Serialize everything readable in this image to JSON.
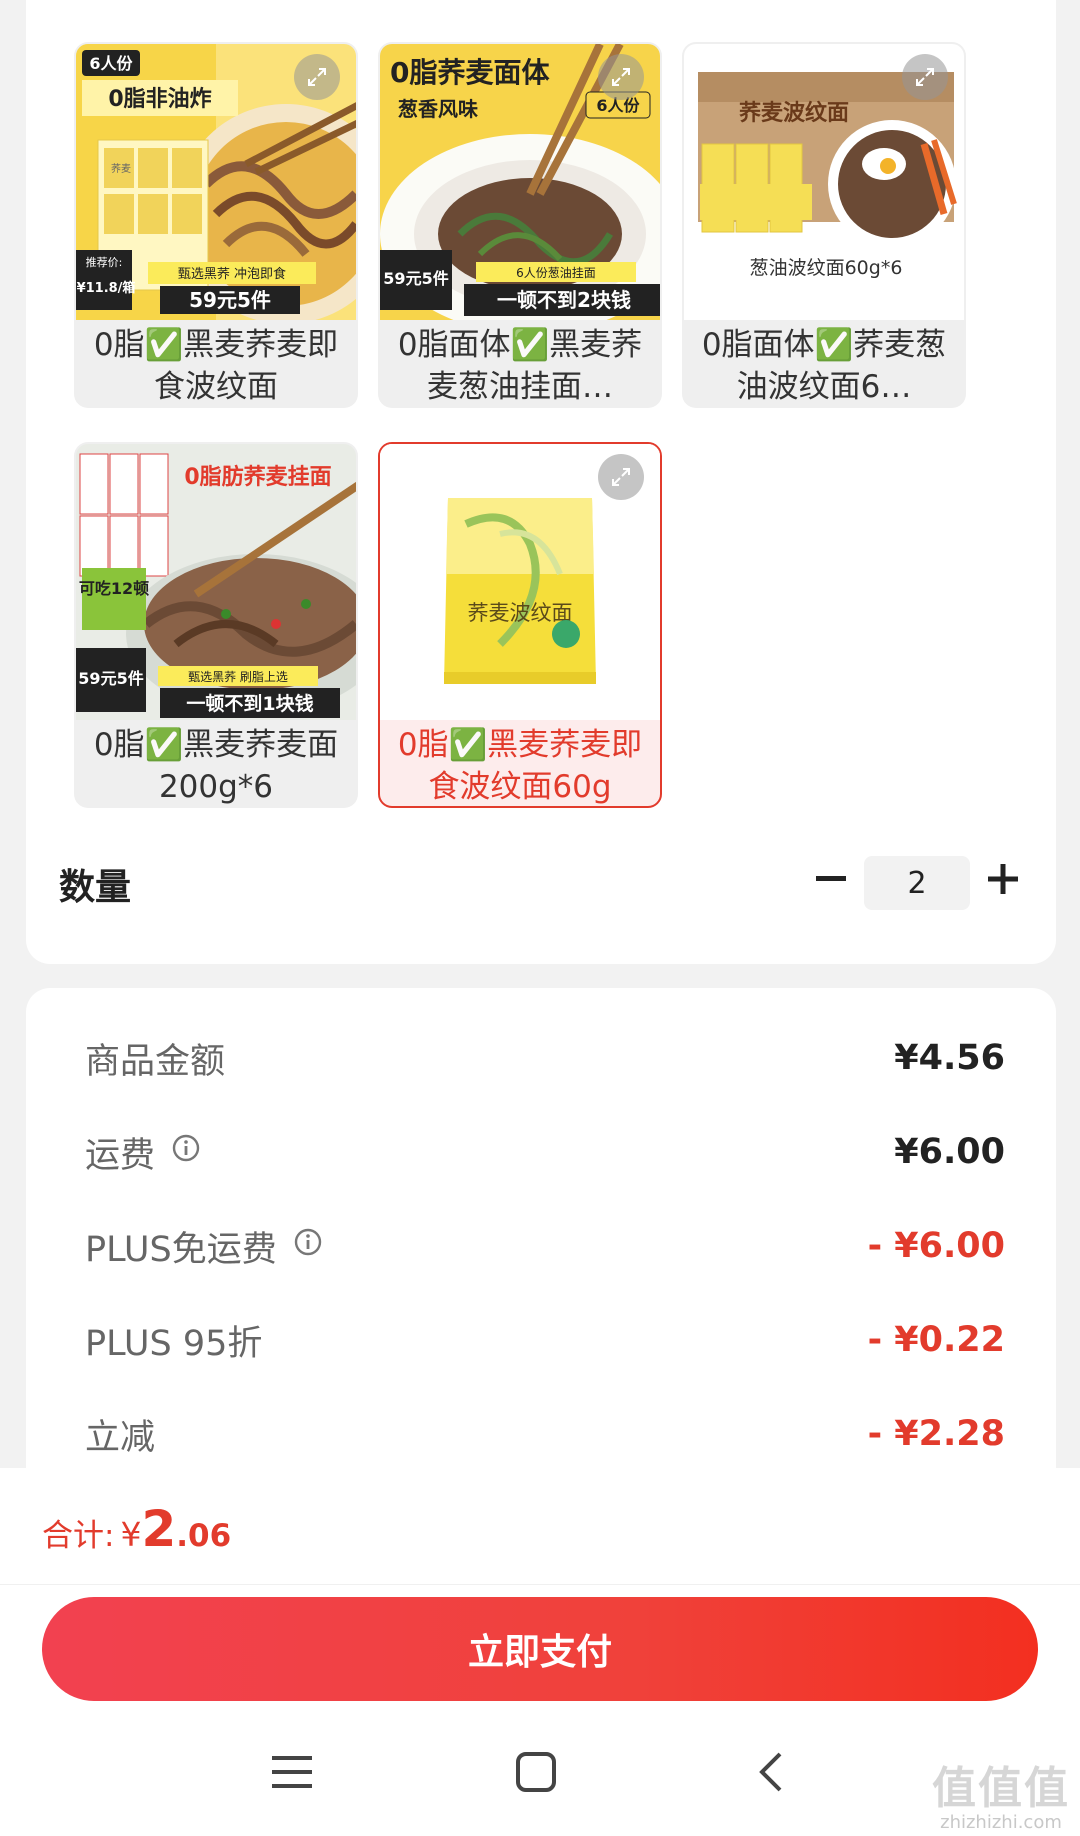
{
  "variants": [
    {
      "label": "0脂✅黑麦荞麦即食波纹面",
      "selected": false,
      "thumb_text": {
        "a": "6人份",
        "b": "0脂非油炸",
        "c": "荞麦",
        "d": "推荐价:",
        "e": "¥11.8/箱",
        "f": "甄选黑荞  冲泡即食",
        "g": "59元5件"
      }
    },
    {
      "label": "0脂面体✅黑麦荞麦葱油挂面…",
      "selected": false,
      "thumb_text": {
        "a": "0脂荞麦面体",
        "b": "葱香风味",
        "c": "6人份",
        "d": "59元5件",
        "e": "6人份葱油挂面",
        "f": "一顿不到2块钱"
      }
    },
    {
      "label": "0脂面体✅荞麦葱油波纹面6…",
      "selected": false,
      "thumb_text": {
        "a": "荞麦波纹面",
        "b": "葱油波纹面60g*6"
      }
    },
    {
      "label": "0脂✅黑麦荞麦面200g*6",
      "selected": false,
      "thumb_text": {
        "a": "0脂肪荞麦挂面",
        "b": "可吃12顿",
        "c": "59元5件",
        "d": "甄选黑荞  刷脂上选",
        "e": "一顿不到1块钱"
      }
    },
    {
      "label": "0脂✅黑麦荞麦即食波纹面60g",
      "selected": true,
      "thumb_text": {
        "a": "荞麦波纹面"
      }
    }
  ],
  "quantity": {
    "label": "数量",
    "value": "2",
    "minus_icon": "minus-icon",
    "plus_icon": "plus-icon"
  },
  "price_rows": [
    {
      "label": "商品金额",
      "value": "¥4.56",
      "info": false,
      "color": "#222222"
    },
    {
      "label": "运费",
      "value": "¥6.00",
      "info": true,
      "color": "#222222"
    },
    {
      "label": "PLUS免运费",
      "value": "- ¥6.00",
      "info": true,
      "color": "#e23b2c"
    },
    {
      "label": "PLUS 95折",
      "value": "- ¥0.22",
      "info": false,
      "color": "#e23b2c"
    },
    {
      "label": "立减",
      "value": "- ¥2.28",
      "info": false,
      "color": "#e23b2c"
    }
  ],
  "total": {
    "label": "合计:",
    "currency": "¥",
    "integer": "2",
    "decimal": ".06"
  },
  "pay_button": "立即支付",
  "nav": {
    "menu_icon": "recent-apps-icon",
    "home_icon": "home-icon",
    "back_icon": "back-icon"
  },
  "watermark": {
    "url": "zhizhizhi.com"
  },
  "colors": {
    "accent": "#e23b2c",
    "pay_gradient_start": "#f24150",
    "pay_gradient_end": "#f32f20"
  }
}
